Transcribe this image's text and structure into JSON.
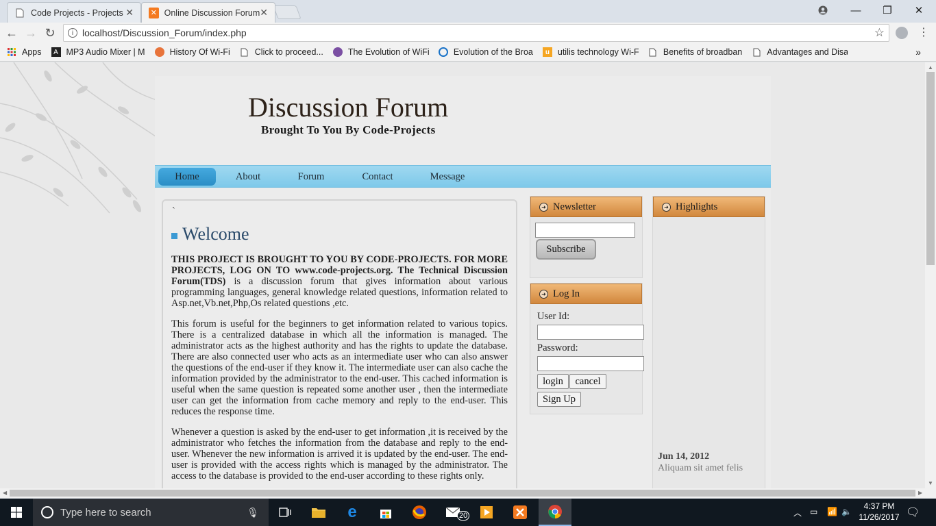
{
  "browser": {
    "tabs": [
      {
        "title": "Code Projects - Projects",
        "close": "✕"
      },
      {
        "title": "Online Discussion Forum",
        "close": "✕"
      }
    ],
    "url": "localhost/Discussion_Forum/index.php",
    "bookmarks": [
      {
        "label": "Apps",
        "icon": "apps-grid-icon"
      },
      {
        "label": "MP3 Audio Mixer | M",
        "icon": "mixer-icon"
      },
      {
        "label": "History Of Wi-Fi",
        "icon": "wifi-history-icon"
      },
      {
        "label": "Click to proceed...",
        "icon": "page-icon"
      },
      {
        "label": "The Evolution of WiFi",
        "icon": "evolution-icon"
      },
      {
        "label": "Evolution of the Broa",
        "icon": "broadband-icon"
      },
      {
        "label": "utilis technology Wi-F",
        "icon": "utilis-icon"
      },
      {
        "label": "Benefits of broadban",
        "icon": "page-icon"
      },
      {
        "label": "Advantages and Disa",
        "icon": "page-icon"
      }
    ],
    "bookmarks_more": "»"
  },
  "site": {
    "title": "Discussion Forum",
    "subtitle": "Brought To You By Code-Projects",
    "nav": [
      "Home",
      "About",
      "Forum",
      "Contact",
      "Message"
    ],
    "tick": "`",
    "welcome_heading": "Welcome",
    "para1_bold": "THIS PROJECT IS BROUGHT TO YOU BY CODE-PROJECTS. FOR MORE PROJECTS, LOG ON TO www.code-projects.org. The Technical Discussion Forum(TDS)",
    "para1_rest": " is a discussion forum that gives information about various programming languages, general knowledge related questions, information related to Asp.net,Vb.net,Php,Os related questions ,etc.",
    "para2": "This forum is useful for the beginners to get information related to various topics. There is a centralized database in which all the information is managed. The administrator acts as the highest authority and has the rights to update the database. There are also connected user who acts as an intermediate user who can also answer the questions of the end-user if they know it. The intermediate user can also cache the information provided by the administrator to the end-user. This cached information is useful when the same question is repeated some another user , then the intermediate user can get the information from cache memory and reply to the end-user. This reduces the response time.",
    "para3": "Whenever a question is asked by the end-user to get information ,it is received by the administrator who fetches the information from the database and reply to the end-user. Whenever the new information is arrived it is updated by the end-user. The end-user is provided with the access rights which is managed by the administrator. The access to the database is provided to the end-user according to these rights only.",
    "newsletter": {
      "heading": "Newsletter",
      "email_value": "",
      "subscribe": "Subscribe"
    },
    "login": {
      "heading": "Log In",
      "userid_label": "User Id:",
      "password_label": "Password:",
      "login_btn": "login",
      "cancel_btn": "cancel",
      "signup_btn": "Sign Up"
    },
    "highlights": {
      "heading": "Highlights",
      "date": "Jun 14, 2012",
      "text": "Aliquam sit amet felis"
    }
  },
  "taskbar": {
    "search_placeholder": "Type here to search",
    "mail_badge": "20",
    "time": "4:37 PM",
    "date": "11/26/2017"
  }
}
